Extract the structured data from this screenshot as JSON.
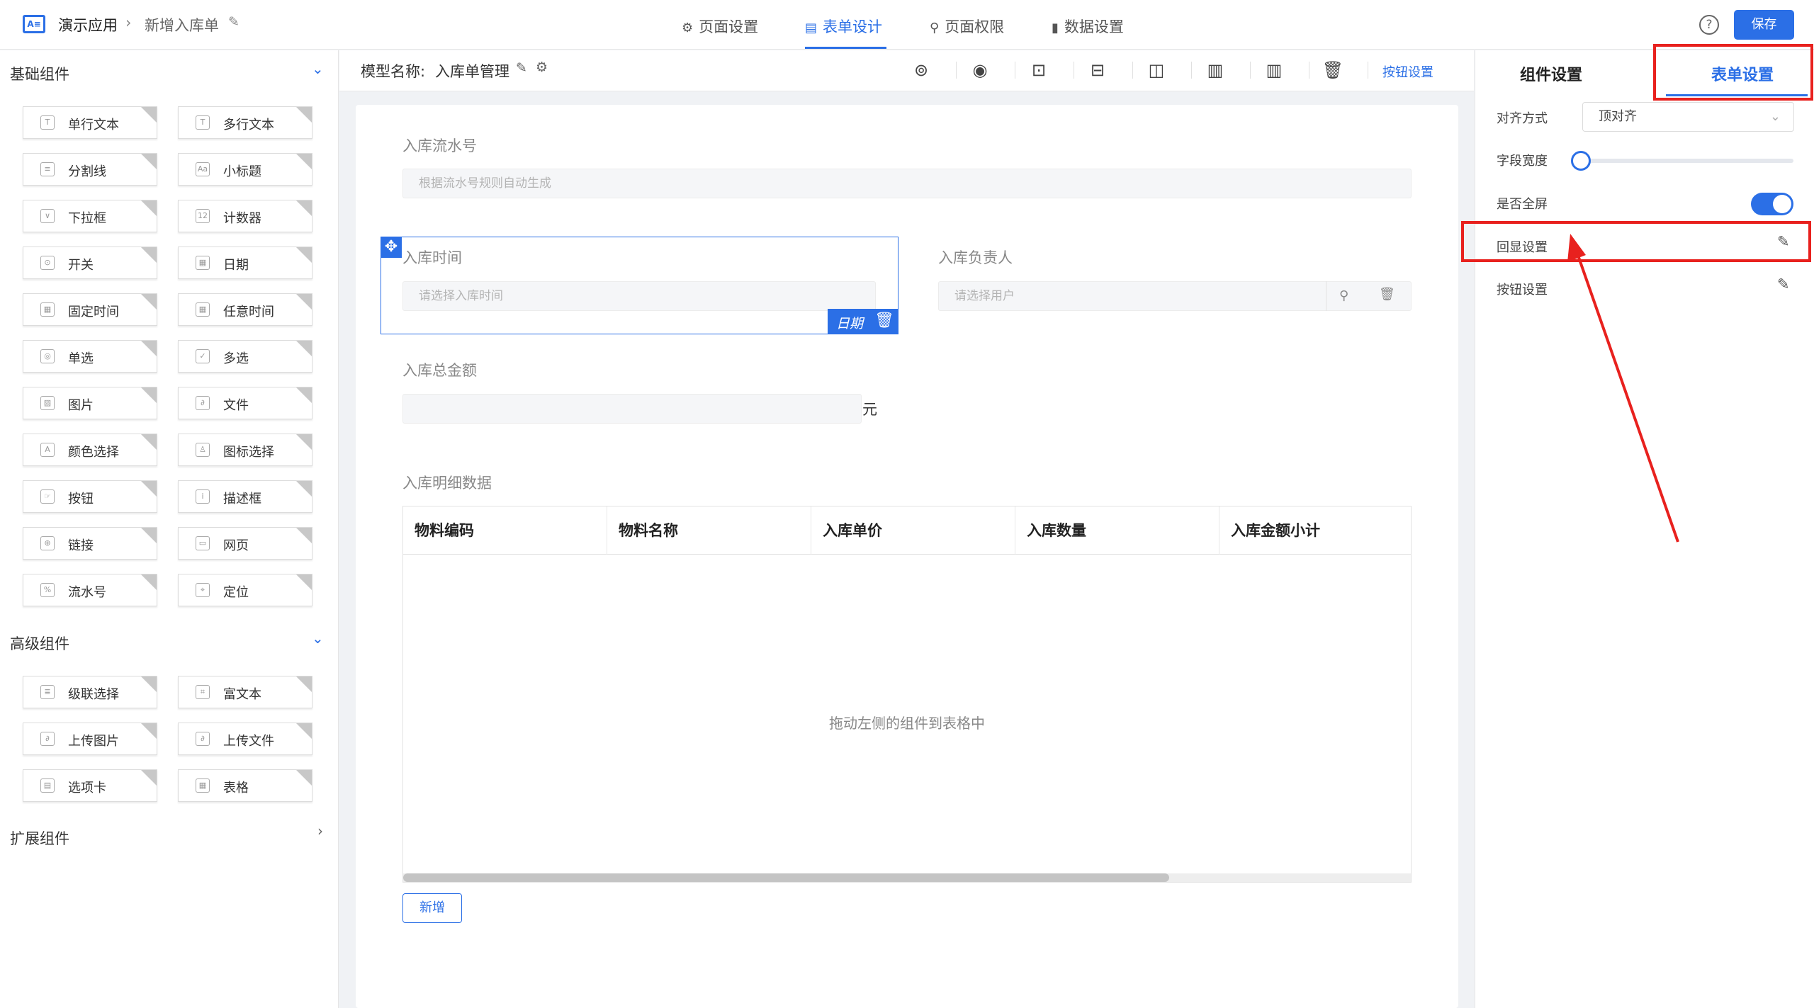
{
  "header": {
    "app_name": "演示应用",
    "breadcrumb_sep": "›",
    "page_name": "新增入库单",
    "edit_glyph": "✎",
    "tabs": [
      {
        "icon": "⚙",
        "label": "页面设置"
      },
      {
        "icon": "▤",
        "label": "表单设计"
      },
      {
        "icon": "⚲",
        "label": "页面权限"
      },
      {
        "icon": "▮",
        "label": "数据设置"
      }
    ],
    "active_tab": "表单设计",
    "help_glyph": "?",
    "save_label": "保存",
    "logo_text": "A≡"
  },
  "left_panel": {
    "basic_title": "基础组件",
    "basic_items": [
      {
        "label": "单行文本",
        "icon": "T"
      },
      {
        "label": "多行文本",
        "icon": "T"
      },
      {
        "label": "分割线",
        "icon": "≡"
      },
      {
        "label": "小标题",
        "icon": "Aa"
      },
      {
        "label": "下拉框",
        "icon": "∨"
      },
      {
        "label": "计数器",
        "icon": "12"
      },
      {
        "label": "开关",
        "icon": "⊙"
      },
      {
        "label": "日期",
        "icon": "▦"
      },
      {
        "label": "固定时间",
        "icon": "▦"
      },
      {
        "label": "任意时间",
        "icon": "▦"
      },
      {
        "label": "单选",
        "icon": "◎"
      },
      {
        "label": "多选",
        "icon": "✓"
      },
      {
        "label": "图片",
        "icon": "▨"
      },
      {
        "label": "文件",
        "icon": "∂"
      },
      {
        "label": "颜色选择",
        "icon": "A"
      },
      {
        "label": "图标选择",
        "icon": "♙"
      },
      {
        "label": "按钮",
        "icon": "☞"
      },
      {
        "label": "描述框",
        "icon": "i"
      },
      {
        "label": "链接",
        "icon": "⊕"
      },
      {
        "label": "网页",
        "icon": "▭"
      },
      {
        "label": "流水号",
        "icon": "%"
      },
      {
        "label": "定位",
        "icon": "⌖"
      }
    ],
    "advanced_title": "高级组件",
    "advanced_items": [
      {
        "label": "级联选择",
        "icon": "≣"
      },
      {
        "label": "富文本",
        "icon": "⌗"
      },
      {
        "label": "上传图片",
        "icon": "∂"
      },
      {
        "label": "上传文件",
        "icon": "∂"
      },
      {
        "label": "选项卡",
        "icon": "▤"
      },
      {
        "label": "表格",
        "icon": "▦"
      }
    ],
    "extended_title": "扩展组件",
    "chevron_down": "⌄",
    "chevron_right": "›"
  },
  "canvas_header": {
    "model_label": "模型名称:",
    "model_name": "入库单管理",
    "edit_glyph": "✎",
    "gear_glyph": "⚙",
    "tools": [
      "⊚",
      "◉",
      "⊡",
      "⊟",
      "◫",
      "▥",
      "▥",
      "🗑"
    ],
    "button_settings": "按钮设置"
  },
  "form": {
    "serial_label": "入库流水号",
    "serial_placeholder": "根据流水号规则自动生成",
    "time_label": "入库时间",
    "time_placeholder": "请选择入库时间",
    "owner_label": "入库负责人",
    "owner_placeholder": "请选择用户",
    "amount_label": "入库总金额",
    "amount_unit": "元",
    "detail_label": "入库明细数据",
    "selected_tag": "日期",
    "move_glyph": "✥",
    "trash_glyph": "🗑",
    "search_glyph": "⚲",
    "table_headers": [
      "物料编码",
      "物料名称",
      "入库单价",
      "入库数量",
      "入库金额小计"
    ],
    "table_empty": "拖动左侧的组件到表格中",
    "table_scroll_fraction": 0.76,
    "add_button": "新增"
  },
  "right_panel": {
    "tabs": [
      "组件设置",
      "表单设置"
    ],
    "active_tab": "表单设置",
    "align_label": "对齐方式",
    "align_value": "顶对齐",
    "chevron": "⌄",
    "width_label": "字段宽度",
    "width_slider_value": 0,
    "fullscreen_label": "是否全屏",
    "fullscreen_on": true,
    "echo_label": "回显设置",
    "button_label": "按钮设置",
    "edit_icon": "✎"
  },
  "colors": {
    "accent": "#2b6fe6",
    "annotation": "#e8211e"
  }
}
